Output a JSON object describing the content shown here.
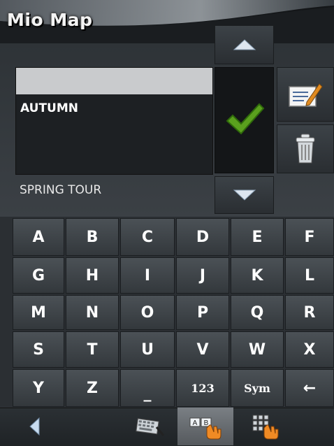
{
  "app": {
    "title": "Mio Map"
  },
  "list": {
    "items": [
      {
        "label": "",
        "selected": true
      },
      {
        "label": "AUTUMN",
        "selected": false
      },
      {
        "label": "SPRING TOUR",
        "selected": false
      }
    ]
  },
  "keyboard": {
    "rows": [
      [
        "A",
        "B",
        "C",
        "D",
        "E",
        "F"
      ],
      [
        "G",
        "H",
        "I",
        "J",
        "K",
        "L"
      ],
      [
        "M",
        "N",
        "O",
        "P",
        "Q",
        "R"
      ],
      [
        "S",
        "T",
        "U",
        "V",
        "W",
        "X"
      ],
      [
        "Y",
        "Z",
        "_",
        "123",
        "Sym",
        "←"
      ]
    ]
  },
  "icons": {
    "scroll_up": "triangle-up-icon",
    "scroll_down": "triangle-down-icon",
    "confirm": "checkmark-icon",
    "edit": "edit-note-icon",
    "delete": "trash-icon",
    "back": "back-arrow-icon",
    "keyboard_qwerty": "keyboard-icon",
    "keyboard_abc": "abc-keyboard-icon",
    "keyboard_numeric": "keypad-icon"
  },
  "colors": {
    "selection": "#c9cbcd",
    "confirm_green": "#5aa01e",
    "hand_orange": "#f08a24"
  }
}
